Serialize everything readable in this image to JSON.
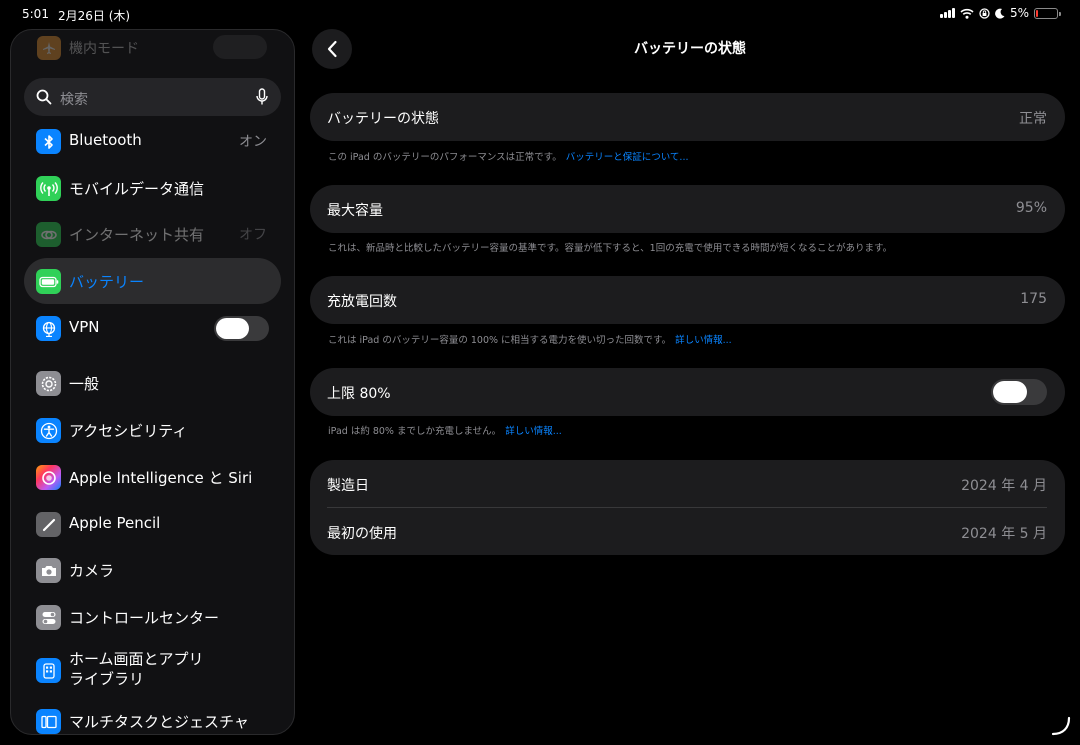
{
  "status_bar": {
    "time": "5:01",
    "date": "2月26日 (木)",
    "battery_percent": "5%",
    "battery_level": 0.05,
    "icons": [
      "cellular-signal-icon",
      "wifi-icon",
      "screen-lock-icon",
      "moon-icon",
      "battery-icon"
    ]
  },
  "sidebar": {
    "airplane_label": "機内モード",
    "search_placeholder": "検索",
    "items": [
      {
        "label": "Bluetooth",
        "value": "オン",
        "icon": "bluetooth-icon",
        "color": "#0a84ff"
      },
      {
        "label": "モバイルデータ通信",
        "icon": "cellular-antenna-icon",
        "color": "#30d158"
      },
      {
        "label": "インターネット共有",
        "value": "オフ",
        "icon": "hotspot-icon",
        "color": "#30d158"
      },
      {
        "label": "バッテリー",
        "icon": "battery-icon",
        "color": "#30d158"
      },
      {
        "label": "VPN",
        "icon": "globe-icon",
        "color": "#0a84ff",
        "toggle": false
      },
      {
        "label": "一般",
        "icon": "gear-icon",
        "color": "#8e8e93"
      },
      {
        "label": "アクセシビリティ",
        "icon": "accessibility-icon",
        "color": "#0a84ff"
      },
      {
        "label": "Apple Intelligence と Siri",
        "icon": "siri-icon",
        "color": "#bf5af2"
      },
      {
        "label": "Apple Pencil",
        "icon": "pencil-icon",
        "color": "#636366"
      },
      {
        "label": "カメラ",
        "icon": "camera-icon",
        "color": "#8e8e93"
      },
      {
        "label": "コントロールセンター",
        "icon": "toggles-icon",
        "color": "#8e8e93"
      },
      {
        "label": "ホーム画面とアプリ\nライブラリ",
        "label_line1": "ホーム画面とアプリ",
        "label_line2": "ライブラリ",
        "icon": "home-screen-icon",
        "color": "#0a84ff"
      },
      {
        "label": "マルチタスクとジェスチャ",
        "icon": "multitask-icon",
        "color": "#0a84ff"
      }
    ]
  },
  "main": {
    "title": "バッテリーの状態",
    "health": {
      "label": "バッテリーの状態",
      "value": "正常"
    },
    "health_note": "この iPad のバッテリーのパフォーマンスは正常です。",
    "health_link": "バッテリーと保証について...",
    "capacity": {
      "label": "最大容量",
      "value": "95%"
    },
    "capacity_note": "これは、新品時と比較したバッテリー容量の基準です。容量が低下すると、1回の充電で使用できる時間が短くなることがあります。",
    "cycles": {
      "label": "充放電回数",
      "value": "175"
    },
    "cycles_note": "これは iPad のバッテリー容量の 100% に相当する電力を使い切った回数です。",
    "cycles_link": "詳しい情報...",
    "limit": {
      "label": "上限 80%",
      "enabled": false
    },
    "limit_note": "iPad は約 80% までしか充電しません。",
    "limit_link": "詳しい情報...",
    "manufacture": {
      "label": "製造日",
      "value": "2024 年 4 月"
    },
    "first_use": {
      "label": "最初の使用",
      "value": "2024 年 5 月"
    }
  }
}
